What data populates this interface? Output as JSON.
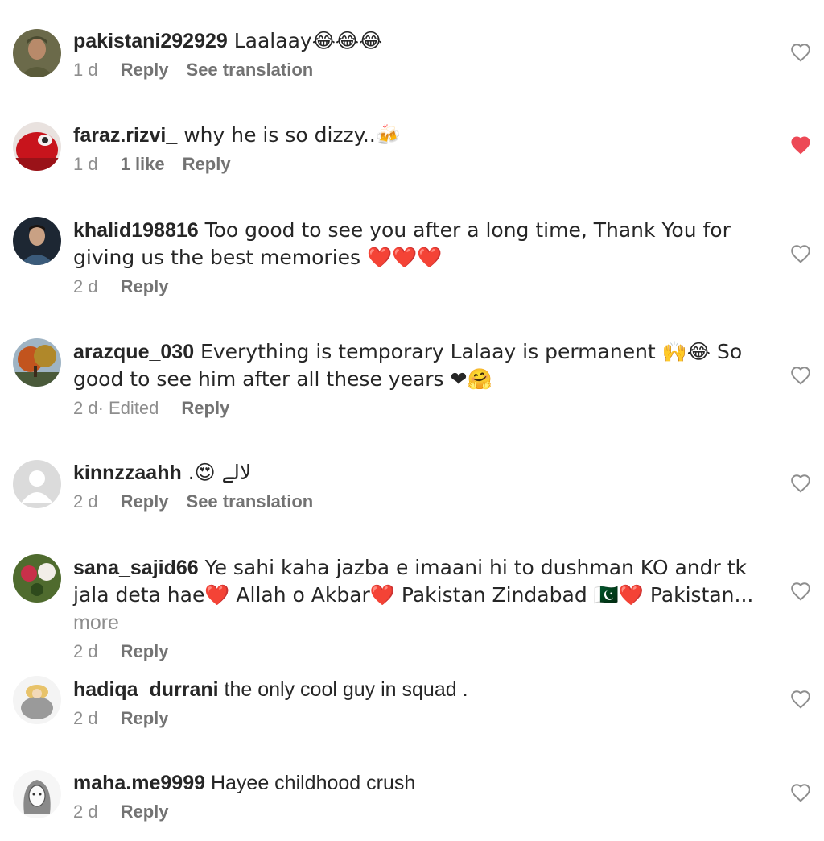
{
  "comments": [
    {
      "username": "pakistani292929",
      "text": " Laalaay😂😂😂",
      "time": "1 d",
      "likes": "",
      "reply": "Reply",
      "see_translation": "See translation",
      "liked": false
    },
    {
      "username": "faraz.rizvi_",
      "text": " why he is so dizzy..🍻",
      "time": "1 d",
      "likes": "1 like",
      "reply": "Reply",
      "see_translation": "",
      "liked": true
    },
    {
      "username": "khalid198816",
      "text": " Too good to see you after a long time, Thank You for giving us the best memories ❤️❤️❤️",
      "time": "2 d",
      "likes": "",
      "reply": "Reply",
      "see_translation": "",
      "liked": false
    },
    {
      "username": "arazque_030",
      "text": " Everything is temporary Lalaay is permanent 🙌😂 So good to see him after all these years ❤🤗",
      "time": "2 d· Edited",
      "likes": "",
      "reply": "Reply",
      "see_translation": "",
      "liked": false
    },
    {
      "username": "kinnzzaahh",
      "text": " .😍 لالے",
      "time": "2 d",
      "likes": "",
      "reply": "Reply",
      "see_translation": "See translation",
      "liked": false
    },
    {
      "username": "sana_sajid66",
      "text": " Ye sahi kaha jazba e imaani hi to dushman KO andr tk jala deta hae❤️ Allah o Akbar❤️ Pakistan Zindabad 🇵🇰❤️ Pakistan...",
      "more": " more",
      "time": "2 d",
      "likes": "",
      "reply": "Reply",
      "see_translation": "",
      "liked": false
    },
    {
      "username": "hadiqa_durrani",
      "text": " the only cool guy in squad .",
      "time": "2 d",
      "likes": "",
      "reply": "Reply",
      "see_translation": "",
      "liked": false
    },
    {
      "username": "maha.me9999",
      "text": " Hayee childhood crush",
      "time": "2 d",
      "likes": "",
      "reply": "Reply",
      "see_translation": "",
      "liked": false
    }
  ],
  "colors": {
    "text": "#262626",
    "secondary": "#8e8e8e",
    "liked_heart": "#ed4956",
    "outline_heart": "#8e8e8e"
  },
  "icons": {
    "like": "heart-outline-icon",
    "liked": "heart-filled-icon"
  }
}
